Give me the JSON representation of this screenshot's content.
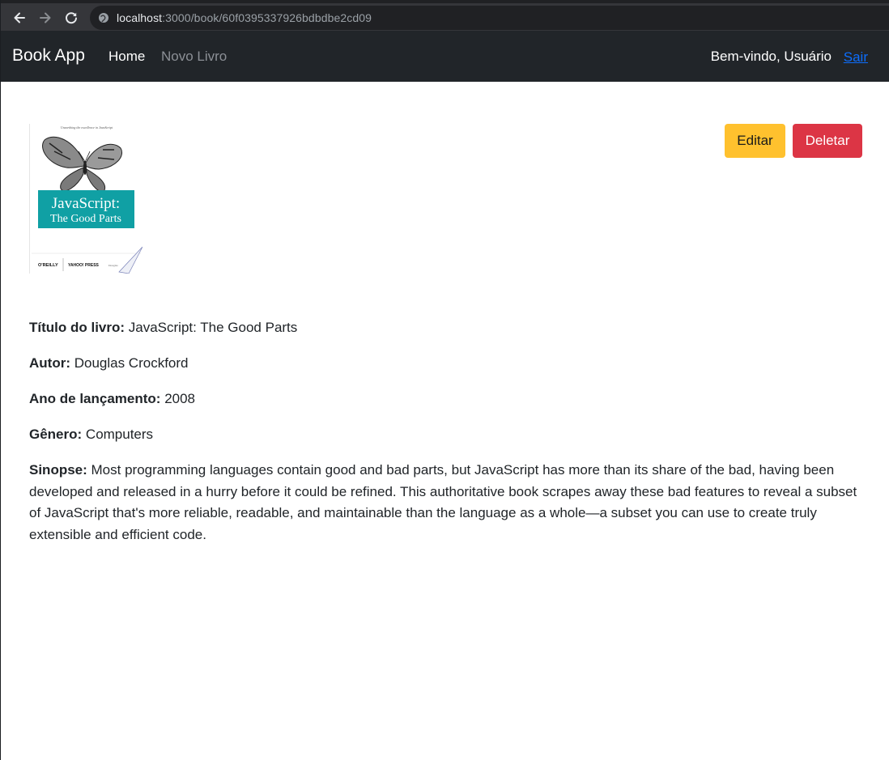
{
  "browser": {
    "url_host": "localhost",
    "url_path": ":3000/book/60f0395337926bdbdbe2cd09"
  },
  "navbar": {
    "brand": "Book App",
    "links": [
      "Home",
      "Novo Livro"
    ],
    "welcome": "Bem-vindo, Usuário",
    "logout": "Sair"
  },
  "book": {
    "cover": {
      "tagline": "Unearthing the excellence in JavaScript",
      "title_line1": "JavaScript:",
      "title_line2": "The Good Parts",
      "publisher": "O'REILLY",
      "copublisher": "YAHOO! PRESS",
      "author_small": "Douglas"
    },
    "fields": [
      {
        "label": "Título do livro:",
        "value": " JavaScript: The Good Parts"
      },
      {
        "label": "Autor:",
        "value": " Douglas Crockford"
      },
      {
        "label": "Ano de lançamento:",
        "value": " 2008"
      },
      {
        "label": "Gênero:",
        "value": " Computers"
      }
    ],
    "synopsis": {
      "label": "Sinopse:",
      "value": " Most programming languages contain good and bad parts, but JavaScript has more than its share of the bad, having been developed and released in a hurry before it could be refined. This authoritative book scrapes away these bad features to reveal a subset of JavaScript that's more reliable, readable, and maintainable than the language as a whole—a subset you can use to create truly extensible and efficient code."
    }
  },
  "actions": {
    "edit": "Editar",
    "delete": "Deletar"
  },
  "colors": {
    "navbar_bg": "#212529",
    "edit_button": "#ffc12e",
    "delete_button": "#dc3545",
    "link": "#0d6efd",
    "cover_teal": "#10a0a4"
  }
}
